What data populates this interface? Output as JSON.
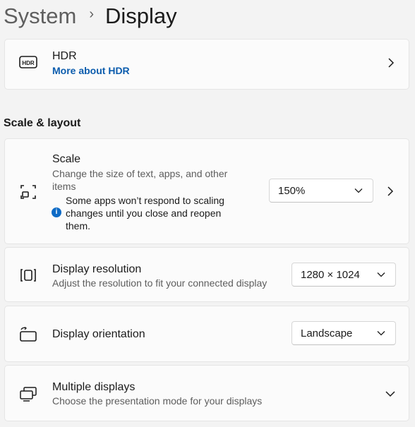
{
  "breadcrumb": {
    "parent": "System",
    "separator": "›",
    "current": "Display"
  },
  "hdr": {
    "icon": "hdr-icon",
    "title": "HDR",
    "link": "More about HDR"
  },
  "section": {
    "heading": "Scale & layout"
  },
  "scale": {
    "icon": "scale-icon",
    "title": "Scale",
    "description": "Change the size of text, apps, and other items",
    "note": "Some apps won’t respond to scaling changes until you close and reopen them.",
    "value": "150%"
  },
  "resolution": {
    "icon": "display-resolution-icon",
    "title": "Display resolution",
    "description": "Adjust the resolution to fit your connected display",
    "value": "1280 × 1024"
  },
  "orientation": {
    "icon": "display-orientation-icon",
    "title": "Display orientation",
    "value": "Landscape"
  },
  "multiple": {
    "icon": "multiple-displays-icon",
    "title": "Multiple displays",
    "description": "Choose the presentation mode for your displays"
  },
  "colors": {
    "accent_link": "#0b5cad",
    "info_blue": "#0e6bc6"
  }
}
